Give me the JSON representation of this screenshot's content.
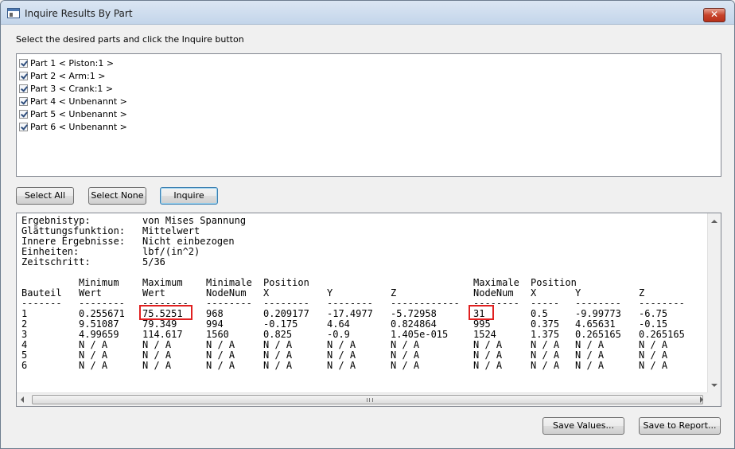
{
  "window": {
    "title": "Inquire Results By Part",
    "close_glyph": "✕"
  },
  "instruction": "Select the desired parts and click the Inquire button",
  "parts": [
    {
      "label": "Part 1 < Piston:1 >",
      "checked": true
    },
    {
      "label": "Part 2 < Arm:1 >",
      "checked": true
    },
    {
      "label": "Part 3 < Crank:1 >",
      "checked": true
    },
    {
      "label": "Part 4 < Unbenannt >",
      "checked": true
    },
    {
      "label": "Part 5 < Unbenannt >",
      "checked": true
    },
    {
      "label": "Part 6 < Unbenannt >",
      "checked": true
    }
  ],
  "buttons": {
    "select_all": "Select All",
    "select_none": "Select None",
    "inquire": "Inquire",
    "save_values": "Save Values...",
    "save_to_report": "Save to Report..."
  },
  "results": {
    "meta": [
      {
        "key": "Ergebnistyp:",
        "value": "von Mises Spannung"
      },
      {
        "key": "Glättungsfunktion:",
        "value": "Mittelwert"
      },
      {
        "key": "Innere Ergebnisse:",
        "value": "Nicht einbezogen"
      },
      {
        "key": "Einheiten:",
        "value": "lbf/(in^2)"
      },
      {
        "key": "Zeitschritt:",
        "value": "5/36"
      }
    ],
    "header_top": {
      "minimum": "Minimum",
      "maximum": "Maximum",
      "minimale": "Minimale",
      "position1": "Position",
      "maximale": "Maximale",
      "position2": "Position"
    },
    "header_bottom": {
      "bauteil": "Bauteil",
      "wert_min": "Wert",
      "wert_max": "Wert",
      "nodenum_min": "NodeNum",
      "x1": "X",
      "y1": "Y",
      "z1": "Z",
      "nodenum_max": "NodeNum",
      "x2": "X",
      "y2": "Y",
      "z2": "Z"
    },
    "separator": {
      "bauteil": "-------",
      "min": "--------",
      "max": "--------",
      "node_min": "--------",
      "x1": "--------",
      "y1": "--------",
      "z1": "------------",
      "node_max": "--------",
      "x2": "-----",
      "y2": "--------",
      "z2": "--------"
    },
    "rows": [
      [
        "1",
        "0.255671",
        "75.5251",
        "968",
        "0.209177",
        "-17.4977",
        "-5.72958",
        "31",
        "0.5",
        "-9.99773",
        "-6.75"
      ],
      [
        "2",
        "9.51087",
        "79.349",
        "994",
        "-0.175",
        "4.64",
        "0.824864",
        "995",
        "0.375",
        "4.65631",
        "-0.15"
      ],
      [
        "3",
        "4.99659",
        "114.617",
        "1560",
        "0.825",
        "-0.9",
        "1.405e-015",
        "1524",
        "1.375",
        "0.265165",
        "0.265165"
      ],
      [
        "4",
        "N / A",
        "N / A",
        "N / A",
        "N / A",
        "N / A",
        "N / A",
        "N / A",
        "N / A",
        "N / A",
        "N / A"
      ],
      [
        "5",
        "N / A",
        "N / A",
        "N / A",
        "N / A",
        "N / A",
        "N / A",
        "N / A",
        "N / A",
        "N / A",
        "N / A"
      ],
      [
        "6",
        "N / A",
        "N / A",
        "N / A",
        "N / A",
        "N / A",
        "N / A",
        "N / A",
        "N / A",
        "N / A",
        "N / A"
      ]
    ],
    "scroll_grip": "|||"
  }
}
